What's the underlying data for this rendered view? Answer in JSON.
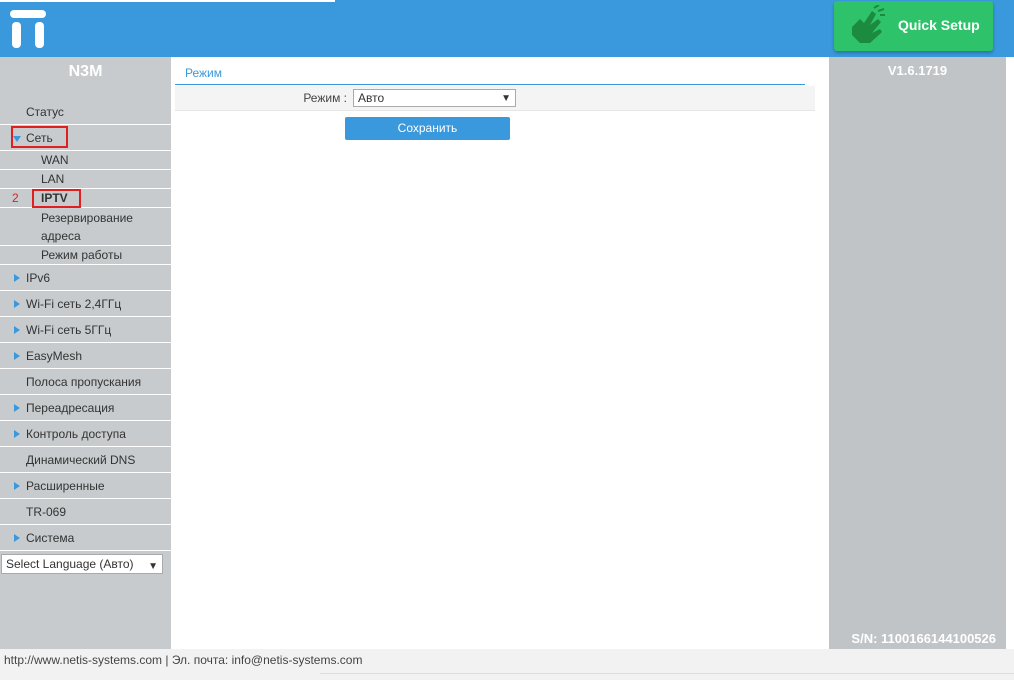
{
  "header": {
    "quick_setup_label": "Quick Setup",
    "accent_color": "#3a98dc",
    "quick_setup_color": "#2ec36b",
    "logo_icon": "netis-logo-icon",
    "quick_setup_icon": "hand-icon"
  },
  "sidebar": {
    "model": "N3M",
    "items": [
      {
        "label": "Статус",
        "arrow": false
      },
      {
        "label": "Сеть",
        "arrow": true,
        "open": true,
        "highlighted": true
      },
      {
        "label": "WAN",
        "sub": true
      },
      {
        "label": "LAN",
        "sub": true
      },
      {
        "label": "IPTV",
        "sub": true,
        "highlighted": true,
        "step": "2"
      },
      {
        "label": "Резервирование адреса",
        "sub": true
      },
      {
        "label": "Режим работы",
        "sub": true
      },
      {
        "label": "IPv6",
        "arrow": true
      },
      {
        "label": "Wi-Fi сеть 2,4ГГц",
        "arrow": true
      },
      {
        "label": "Wi-Fi сеть 5ГГц",
        "arrow": true
      },
      {
        "label": "EasyMesh",
        "arrow": true
      },
      {
        "label": "Полоса пропускания",
        "arrow": false
      },
      {
        "label": "Переадресация",
        "arrow": true
      },
      {
        "label": "Контроль доступа",
        "arrow": true
      },
      {
        "label": "Динамический DNS",
        "arrow": false
      },
      {
        "label": "Расширенные",
        "arrow": true
      },
      {
        "label": "TR-069",
        "arrow": false
      },
      {
        "label": "Система",
        "arrow": true
      }
    ],
    "language_select": "Select Language (Авто)"
  },
  "main": {
    "section_title": "Режим",
    "mode_label": "Режим :",
    "mode_value": "Авто",
    "save_label": "Сохранить"
  },
  "right_panel": {
    "version": "V1.6.1719",
    "serial": "S/N: 1100166144100526"
  },
  "footer": {
    "text": "http://www.netis-systems.com | Эл. почта: info@netis-systems.com"
  }
}
